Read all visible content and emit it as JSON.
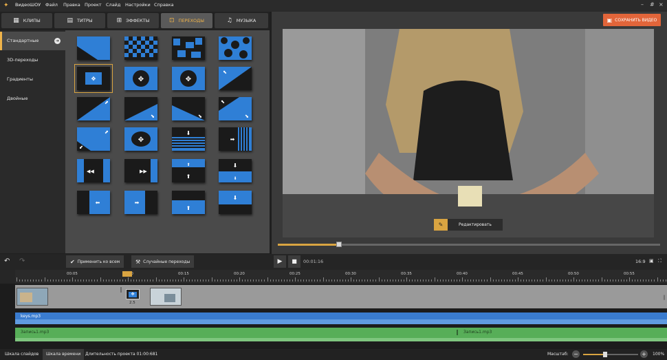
{
  "app": {
    "title": "ВидеоШОУ"
  },
  "menu": {
    "file": "Файл",
    "edit": "Правка",
    "project": "Проект",
    "slide": "Слайд",
    "settings": "Настройки",
    "help": "Справка"
  },
  "window_controls": {
    "minimize": "–",
    "restore": "#",
    "close": "×"
  },
  "tabs": [
    {
      "label": "КЛИПЫ",
      "icon": "film-icon"
    },
    {
      "label": "ТИТРЫ",
      "icon": "text-icon"
    },
    {
      "label": "ЭФФЕКТЫ",
      "icon": "effects-icon"
    },
    {
      "label": "ПЕРЕХОДЫ",
      "icon": "transition-icon",
      "active": true
    },
    {
      "label": "МУЗЫКА",
      "icon": "music-icon"
    }
  ],
  "categories": [
    {
      "label": "Стандартные",
      "active": true
    },
    {
      "label": "3D-переходы"
    },
    {
      "label": "Градиенты"
    },
    {
      "label": "Двойные"
    }
  ],
  "save_button": "СОХРАНИТЬ ВИДЕО",
  "edit_button": "Редактировать",
  "seek_progress": 0.16,
  "toolbar": {
    "apply_all": "Применить ко всем",
    "random": "Случайные переходы",
    "time": "00:01:16",
    "aspect": "16:9"
  },
  "ruler_labels": [
    "00:05",
    "00:10",
    "00:15",
    "00:20",
    "00:25",
    "00:30",
    "00:35",
    "00:40",
    "00:45",
    "00:50",
    "00:55"
  ],
  "timeline": {
    "transition_duration": "2.5",
    "audio1_name": "keys.mp3",
    "audio2_left": "Запись1.mp3",
    "audio2_right": "Запись1.mp3"
  },
  "bottom": {
    "slides_tab": "Шкала слайдов",
    "timeline_tab": "Шкала времени",
    "duration": "Длительность проекта 01:00:681",
    "zoom_label": "Масштаб:",
    "zoom_value": "100%",
    "zoom_level": 0.4
  },
  "colors": {
    "accent": "#f0b44a",
    "save": "#e2653a",
    "transition_blue": "#2f7fd6"
  }
}
